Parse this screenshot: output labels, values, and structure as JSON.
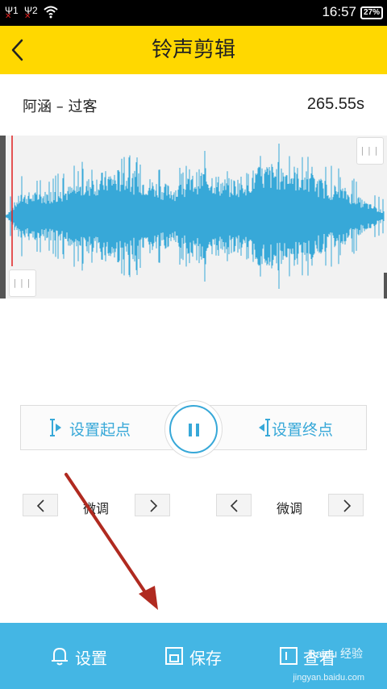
{
  "status_bar": {
    "sim1": "1",
    "sim2": "2",
    "time": "16:57",
    "battery": "27%",
    "icons": [
      "signal-icon",
      "signal-icon",
      "wifi-icon",
      "battery-icon"
    ]
  },
  "header": {
    "title": "铃声剪辑",
    "back_icon": "chevron-left-icon",
    "bg_color": "#ffd800"
  },
  "song": {
    "name": "阿涵 – 过客",
    "duration": "265.55s"
  },
  "waveform": {
    "color": "#37a8d8",
    "handle_glyph": "|||"
  },
  "controls": {
    "set_start_label": "设置起点",
    "set_end_label": "设置终点",
    "play_state": "pause-icon",
    "accent_color": "#37a8d8"
  },
  "fine_tune": {
    "left_label": "微调",
    "right_label": "微调"
  },
  "bottom_bar": {
    "settings_label": "设置",
    "save_label": "保存",
    "view_label": "查看",
    "bg_color": "#44b6e4"
  },
  "watermark": {
    "text": "Baidu 经验",
    "url": "jingyan.baidu.com"
  }
}
